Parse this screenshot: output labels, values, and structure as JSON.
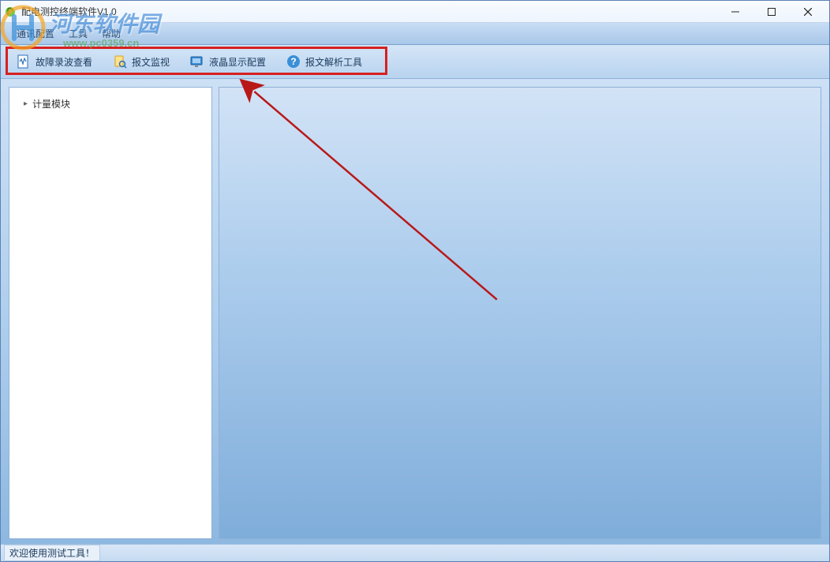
{
  "window": {
    "title": "配电测控终端软件V1.0"
  },
  "menubar": {
    "items": [
      "通讯配置",
      "工具",
      "帮助"
    ]
  },
  "toolbar": {
    "buttons": [
      {
        "label": "故障录波查看",
        "icon": "wave-doc"
      },
      {
        "label": "报文监视",
        "icon": "find-doc"
      },
      {
        "label": "液晶显示配置",
        "icon": "monitor"
      },
      {
        "label": "报文解析工具",
        "icon": "help-doc"
      }
    ]
  },
  "tree": {
    "root": {
      "label": "计量模块"
    }
  },
  "statusbar": {
    "text": "欢迎使用测试工具！"
  },
  "watermark": {
    "title": "河东软件园",
    "url": "www.pc0359.cn"
  },
  "colors": {
    "highlight": "#d62020",
    "arrow": "#b81818"
  }
}
